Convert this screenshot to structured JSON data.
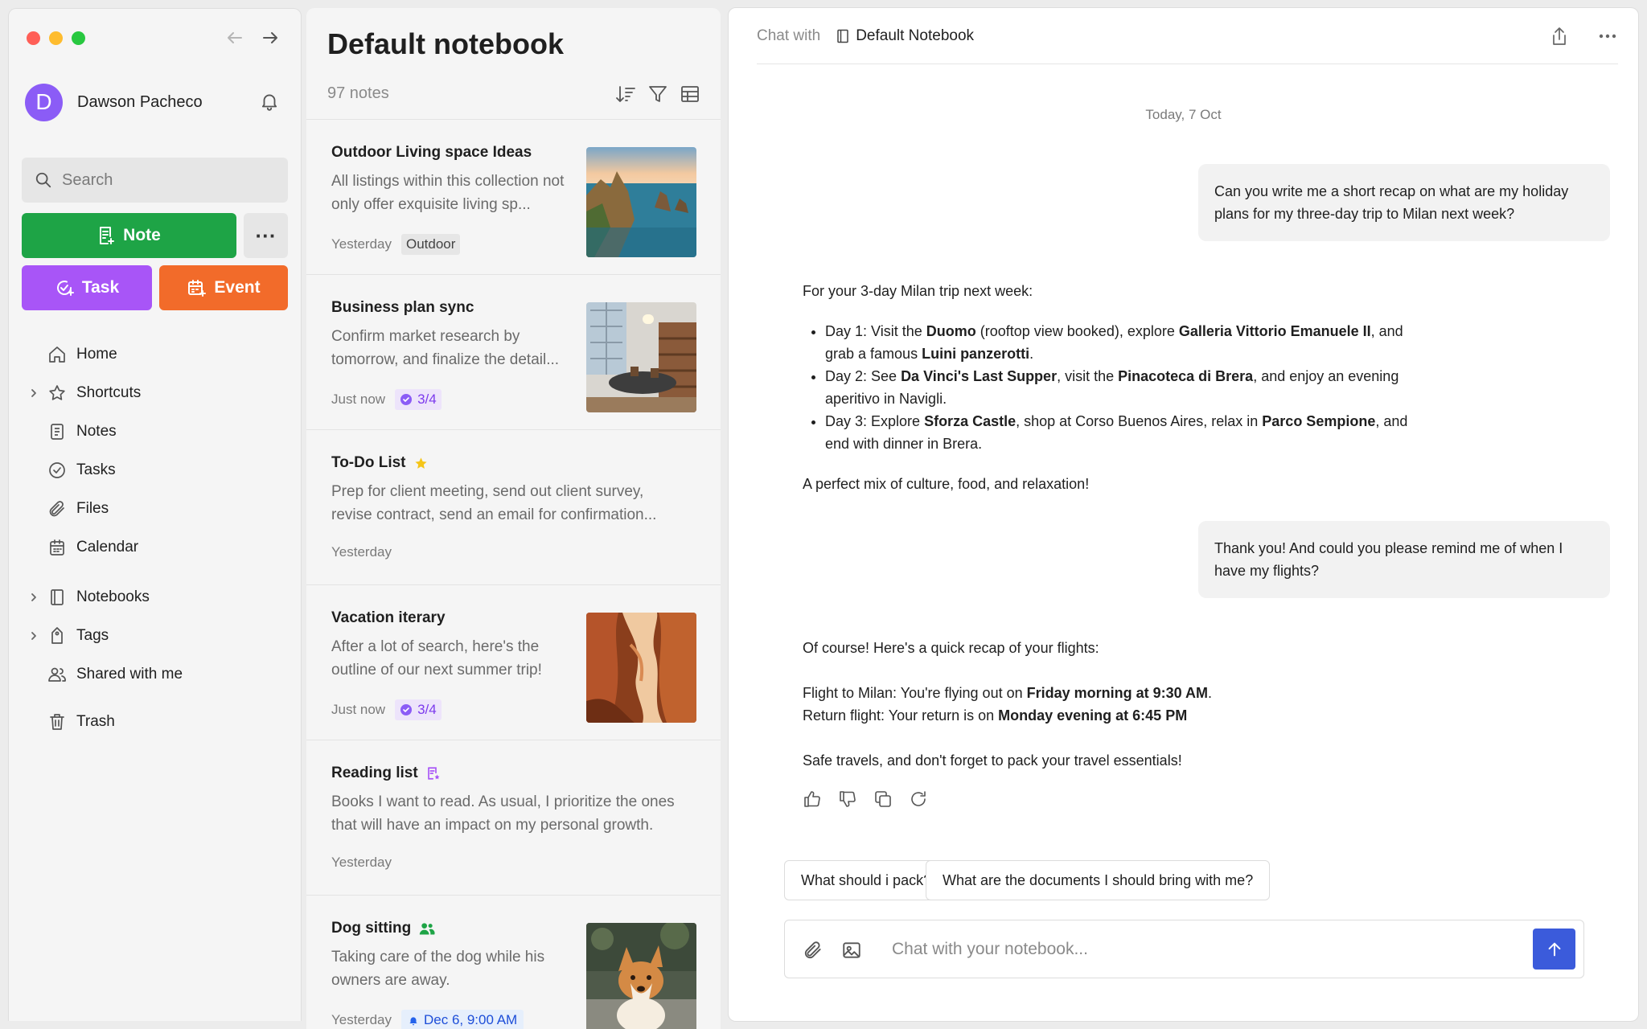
{
  "sidebar": {
    "user_name": "Dawson Pacheco",
    "avatar_letter": "D",
    "search_placeholder": "Search",
    "note_label": "Note",
    "task_label": "Task",
    "event_label": "Event",
    "more_label": "···",
    "nav": [
      {
        "label": "Home",
        "icon": "home-icon"
      },
      {
        "label": "Shortcuts",
        "icon": "star-icon"
      },
      {
        "label": "Notes",
        "icon": "note-icon"
      },
      {
        "label": "Tasks",
        "icon": "task-icon"
      },
      {
        "label": "Files",
        "icon": "paperclip-icon"
      },
      {
        "label": "Calendar",
        "icon": "calendar-icon"
      },
      {
        "label": "Notebooks",
        "icon": "notebook-icon"
      },
      {
        "label": "Tags",
        "icon": "tag-icon"
      },
      {
        "label": "Shared with me",
        "icon": "people-icon"
      },
      {
        "label": "Trash",
        "icon": "trash-icon"
      }
    ]
  },
  "list": {
    "title": "Default notebook",
    "count": "97 notes",
    "notes": [
      {
        "title": "Outdoor Living space Ideas",
        "desc": "All listings within this collection not only offer exquisite living sp...",
        "time": "Yesterday",
        "tag": "Outdoor"
      },
      {
        "title": "Business plan sync",
        "desc": "Confirm market research by tomorrow, and finalize the detail...",
        "time": "Just now",
        "progress": "3/4"
      },
      {
        "title": "To-Do List",
        "desc": "Prep for client meeting, send out client survey, revise contract, send an email for confirmation...",
        "time": "Yesterday"
      },
      {
        "title": "Vacation iterary",
        "desc": "After a lot of search, here's the outline of our next summer trip!",
        "time": "Just now",
        "progress": "3/4"
      },
      {
        "title": "Reading list",
        "desc": "Books I want to read. As usual, I prioritize the ones that will have an impact on my personal growth.",
        "time": "Yesterday"
      },
      {
        "title": "Dog sitting",
        "desc": "Taking care of the dog while his owners are away.",
        "time": "Yesterday",
        "reminder": "Dec 6, 9:00 AM"
      }
    ]
  },
  "chat": {
    "with_label": "Chat with",
    "notebook_name": "Default Notebook",
    "date": "Today,  7 Oct",
    "msg1": "Can you write me a short recap on what are my holiday plans for my three-day trip to Milan next week?",
    "reply1": {
      "intro": "For your 3-day Milan trip next week:",
      "d1_a": "Day 1: Visit the ",
      "d1_b": "Duomo",
      "d1_c": " (rooftop view booked), explore ",
      "d1_d": "Galleria Vittorio Emanuele II",
      "d1_e": ", and grab a famous ",
      "d1_f": "Luini panzerotti",
      "d1_g": ".",
      "d2_a": "Day 2: See ",
      "d2_b": "Da Vinci's Last Supper",
      "d2_c": ", visit the ",
      "d2_d": "Pinacoteca di Brera",
      "d2_e": ", and enjoy an evening aperitivo in Navigli.",
      "d3_a": "Day 3: Explore ",
      "d3_b": "Sforza Castle",
      "d3_c": ", shop at Corso Buenos Aires, relax in ",
      "d3_d": "Parco Sempione",
      "d3_e": ", and end with dinner in Brera.",
      "outro": "A perfect mix of culture, food, and relaxation!"
    },
    "msg2": "Thank you! And could you please remind me of when I have my flights?",
    "reply2": {
      "intro": "Of course! Here's a quick recap of your flights:",
      "f1_a": "Flight to Milan: You're flying out on ",
      "f1_b": "Friday morning at 9:30 AM",
      "f1_c": ".",
      "f2_a": "Return flight: Your return is on ",
      "f2_b": "Monday evening at 6:45 PM",
      "outro": "Safe travels, and don't forget to pack your travel essentials!"
    },
    "suggestions": [
      "What should i pack?",
      "What are the documents I should bring with me?"
    ],
    "input_placeholder": "Chat with your notebook..."
  }
}
